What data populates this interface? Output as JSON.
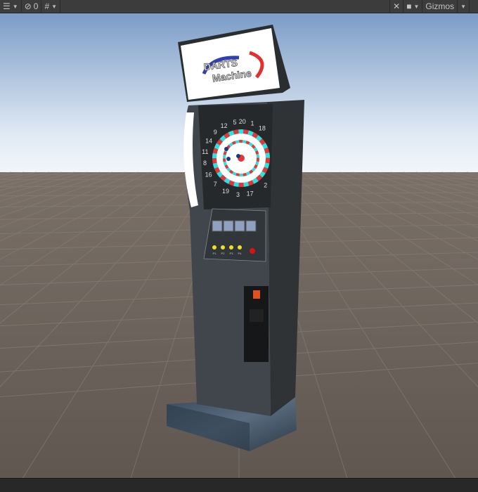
{
  "toolbar": {
    "layers_icon": "layers-icon",
    "hidden_count": "0",
    "grid_icon": "grid-icon",
    "tools_icon": "tools-icon",
    "camera_icon": "camera-icon",
    "gizmos_label": "Gizmos"
  },
  "scene": {
    "logo_line1": "DARTS",
    "logo_line2": "Machine",
    "board_numbers": [
      "5",
      "20",
      "1",
      "18",
      "12",
      "9",
      "14",
      "11",
      "8",
      "16",
      "7",
      "19",
      "3",
      "17",
      "2"
    ],
    "player_labels": [
      "P1",
      "P2",
      "P3",
      "P4"
    ]
  },
  "colors": {
    "sky_top": "#7b9cc6",
    "horizon": "#eef3f8",
    "ground": "#685f57",
    "cabinet": "#3d4246",
    "ring_red": "#e03838",
    "ring_cyan": "#30e0e0"
  }
}
